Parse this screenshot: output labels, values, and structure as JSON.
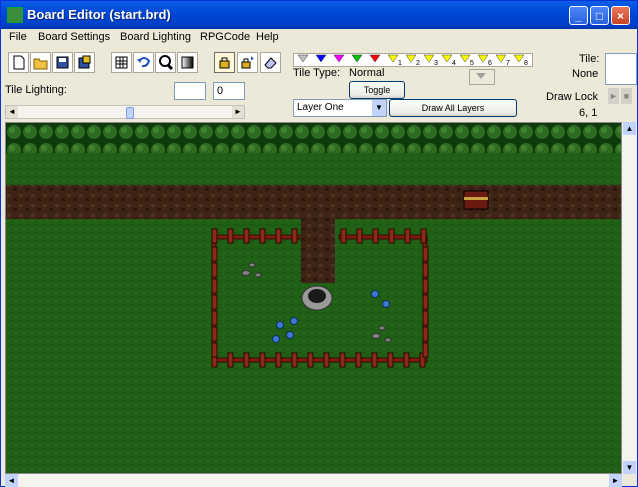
{
  "window": {
    "title": "Board Editor  (start.brd)"
  },
  "menu": [
    "File",
    "Board Settings",
    "Board Lighting",
    "RPGCode",
    "Help"
  ],
  "tool_icons": [
    "new-file-icon",
    "open-folder-icon",
    "save-icon",
    "save-all-icon",
    "grid-icon",
    "undo-icon",
    "magnify-icon",
    "gradient-icon",
    "lock-tile-icon",
    "lock-light-icon",
    "eraser-icon"
  ],
  "palette_markers": [
    "1",
    "2",
    "3",
    "4",
    "5",
    "6",
    "7",
    "8"
  ],
  "palette_colors": [
    "#c0c0c0",
    "#0000ff",
    "#ff00ff",
    "#00c000",
    "#ff0000",
    "#ffff00",
    "#ffff00",
    "#ffff00",
    "#ffff00",
    "#ffff00",
    "#ffff00",
    "#ffff00",
    "#ffff00"
  ],
  "tile_type": {
    "label": "Tile Type:",
    "value": "Normal",
    "toggle": "Toggle"
  },
  "tile": {
    "label": "Tile:",
    "value": "None"
  },
  "tile_lighting": {
    "label": "Tile Lighting:",
    "value": "0"
  },
  "layer": {
    "selected": "Layer One",
    "draw_all": "Draw All Layers"
  },
  "draw_lock": {
    "label": "Draw Lock",
    "coords": "6, 1"
  }
}
